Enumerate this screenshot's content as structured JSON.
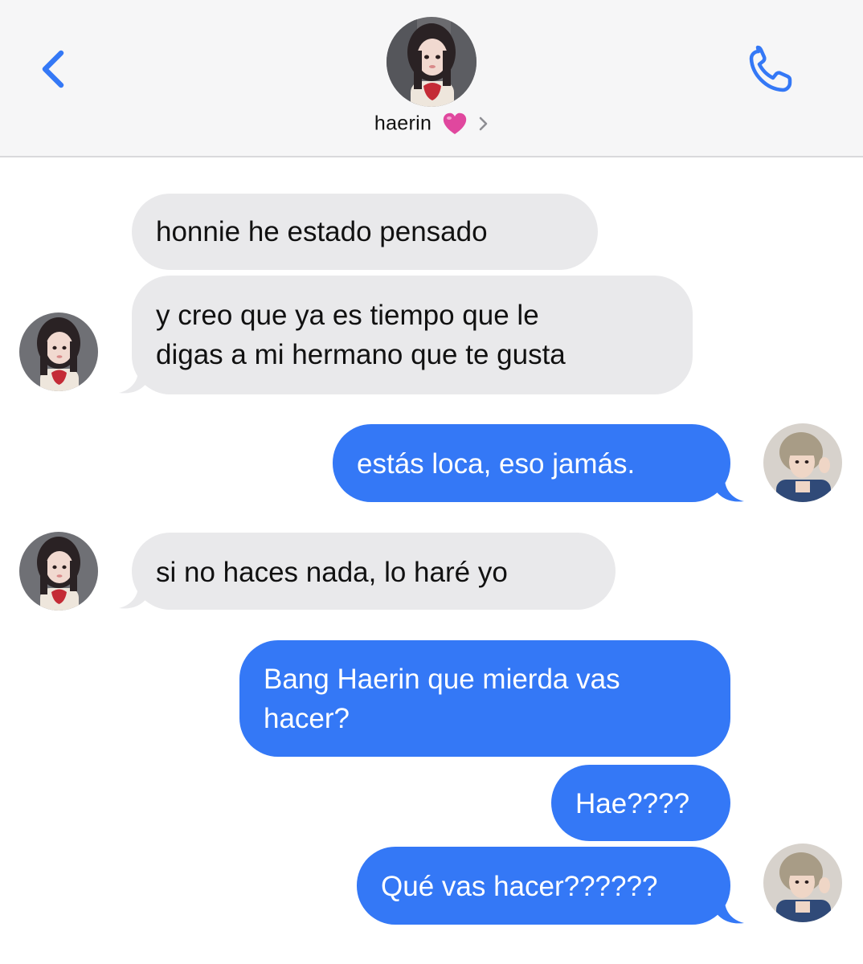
{
  "header": {
    "contact_name": "haerin",
    "back_icon": "chevron-left-icon",
    "call_icon": "phone-icon",
    "name_emoji_icon": "pink-heart-icon",
    "disclosure_icon": "chevron-right-icon"
  },
  "messages": [
    {
      "from": "contact",
      "text": "honnie he estado pensado"
    },
    {
      "from": "contact",
      "lines": [
        "y creo que ya es tiempo que le",
        "digas a mi hermano que te gusta"
      ]
    },
    {
      "from": "me",
      "text": "estás loca, eso jamás."
    },
    {
      "from": "contact",
      "text": "si no haces nada, lo haré yo"
    },
    {
      "from": "me",
      "lines": [
        "Bang Haerin que mierda vas",
        "hacer?"
      ]
    },
    {
      "from": "me",
      "text": "Hae????"
    },
    {
      "from": "me",
      "text": "Qué vas hacer??????"
    }
  ],
  "colors": {
    "header_bg": "#f6f6f7",
    "incoming_bubble": "#e9e9eb",
    "outgoing_bubble": "#3478f6",
    "accent": "#3478f6",
    "heart": "#e0479e"
  }
}
